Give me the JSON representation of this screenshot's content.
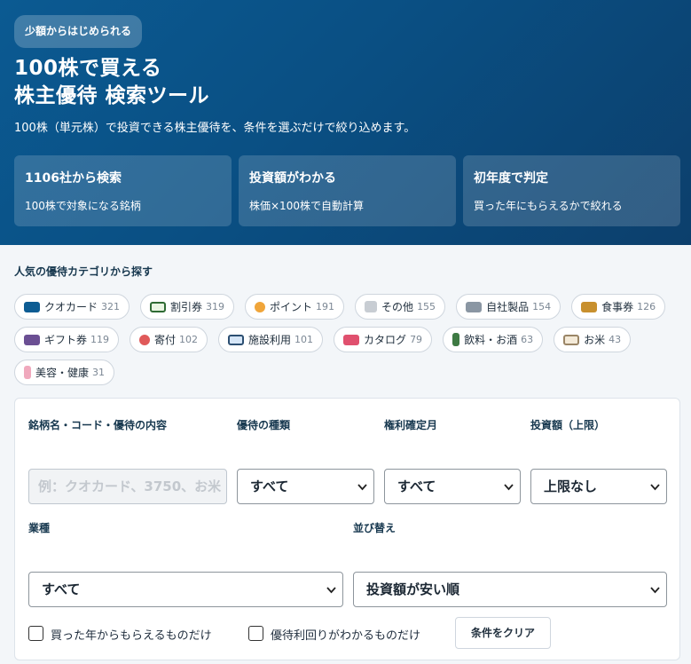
{
  "hero": {
    "badge": "少額からはじめられる",
    "title_line1": "100株で買える",
    "title_line2": "株主優待 検索ツール",
    "subtitle": "100株（単元株）で投資できる株主優待を、条件を選ぶだけで絞り込めます。",
    "features": [
      {
        "title": "1106社から検索",
        "desc": "100株で対象になる銘柄"
      },
      {
        "title": "投資額がわかる",
        "desc": "株価×100株で自動計算"
      },
      {
        "title": "初年度で判定",
        "desc": "買った年にもらえるかで絞れる"
      }
    ]
  },
  "categories": {
    "heading": "人気の優待カテゴリから探す",
    "items": [
      {
        "label": "クオカード",
        "count": "321",
        "color": "#0d5c93",
        "icon": "card-icon"
      },
      {
        "label": "割引券",
        "count": "319",
        "color": "#dff0d8",
        "icon": "ticket-icon"
      },
      {
        "label": "ポイント",
        "count": "191",
        "color": "#f0a53a",
        "icon": "point-icon"
      },
      {
        "label": "その他",
        "count": "155",
        "color": "#c8cdd3",
        "icon": "other-icon"
      },
      {
        "label": "自社製品",
        "count": "154",
        "color": "#8a96a3",
        "icon": "product-icon"
      },
      {
        "label": "食事券",
        "count": "126",
        "color": "#c8902e",
        "icon": "meal-ticket-icon"
      },
      {
        "label": "ギフト券",
        "count": "119",
        "color": "#6b4f93",
        "icon": "gift-card-icon"
      },
      {
        "label": "寄付",
        "count": "102",
        "color": "#e05a5a",
        "icon": "donation-icon"
      },
      {
        "label": "施設利用",
        "count": "101",
        "color": "#d6e6f7",
        "icon": "facility-icon"
      },
      {
        "label": "カタログ",
        "count": "79",
        "color": "#e0506e",
        "icon": "catalog-icon"
      },
      {
        "label": "飲料・お酒",
        "count": "63",
        "color": "#3e7a43",
        "icon": "drink-icon"
      },
      {
        "label": "お米",
        "count": "43",
        "color": "#f4ead8",
        "icon": "rice-icon"
      },
      {
        "label": "美容・健康",
        "count": "31",
        "color": "#f0a9bd",
        "icon": "beauty-icon"
      }
    ]
  },
  "filters": {
    "keyword_label": "銘柄名・コード・優待の内容",
    "keyword_placeholder": "例：クオカード、3750、お米",
    "type_label": "優待の種類",
    "type_value": "すべて",
    "month_label": "権利確定月",
    "month_value": "すべて",
    "amount_label": "投資額（上限）",
    "amount_value": "上限なし",
    "industry_label": "業種",
    "industry_value": "すべて",
    "sort_label": "並び替え",
    "sort_value": "投資額が安い順",
    "check_first_year": "買った年からもらえるものだけ",
    "check_yield": "優待利回りがわかるものだけ",
    "clear_button": "条件をクリア"
  }
}
